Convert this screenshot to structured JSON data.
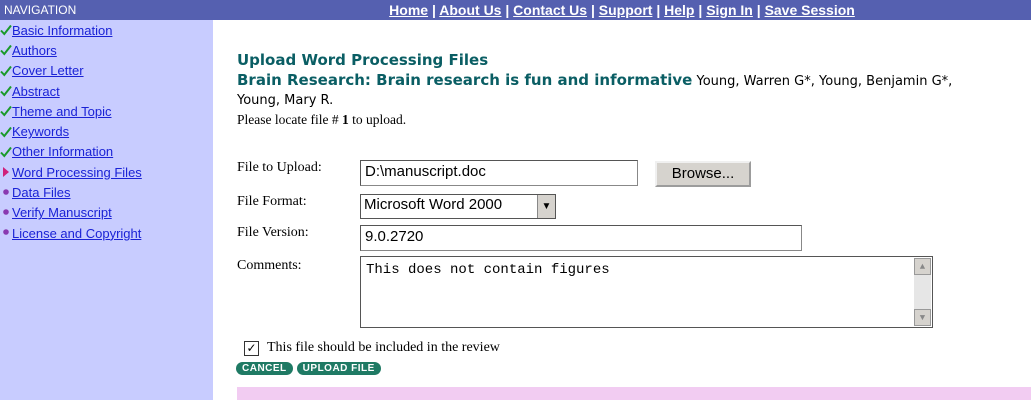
{
  "nav": {
    "header": "NAVIGATION",
    "items": [
      {
        "label": "Basic Information",
        "mark": "check"
      },
      {
        "label": "Authors",
        "mark": "check"
      },
      {
        "label": "Cover Letter",
        "mark": "check"
      },
      {
        "label": "Abstract",
        "mark": "check"
      },
      {
        "label": "Theme and Topic",
        "mark": "check"
      },
      {
        "label": "Keywords",
        "mark": "check"
      },
      {
        "label": "Other Information",
        "mark": "check"
      },
      {
        "label": "Word Processing Files",
        "mark": "arrow"
      },
      {
        "label": "Data Files",
        "mark": "dot"
      },
      {
        "label": "Verify Manuscript",
        "mark": "dot"
      },
      {
        "label": "License and Copyright",
        "mark": "dot"
      }
    ]
  },
  "toplinks": [
    "Home",
    "About Us",
    "Contact Us",
    "Support",
    "Help",
    "Sign In",
    "Save Session"
  ],
  "page": {
    "heading": "Upload Word Processing Files",
    "manuscript_title": "Brain Research: Brain research is fun and informative",
    "authors": "Young, Warren G*, Young, Benjamin G*, Young, Mary R.",
    "instruction_prefix": "Please locate file #",
    "file_number": "1",
    "instruction_suffix": "to upload."
  },
  "form": {
    "file_label": "File to Upload:",
    "file_value": "D:\\manuscript.doc",
    "browse_label": "Browse...",
    "format_label": "File Format:",
    "format_value": "Microsoft Word 2000",
    "version_label": "File Version:",
    "version_value": "9.0.2720",
    "comments_label": "Comments:",
    "comments_value": "This does not contain figures",
    "review_checkbox_label": "This file should be included in the review",
    "review_checked": true
  },
  "buttons": {
    "cancel": "CANCEL",
    "upload": "UPLOAD FILE"
  },
  "colors": {
    "nav_bg": "#c8ccff",
    "header_bar": "#5560b0",
    "teal_heading": "#0a5e64",
    "check_green": "#1a9a2a",
    "arrow_magenta": "#d0207a",
    "dot_purple": "#8a3ab0",
    "button_green": "#1f7a64",
    "pink_bar": "#f2ccf2"
  }
}
